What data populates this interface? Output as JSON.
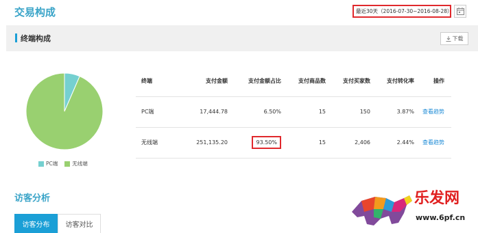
{
  "header": {
    "title": "交易构成",
    "date_range": "最近30天（2016-07-30~2016-08-28）",
    "calendar_icon": "calendar-icon"
  },
  "section": {
    "title": "终端构成",
    "download_label": "下载",
    "download_icon": "download-icon"
  },
  "pie": {
    "legend": [
      "PC端",
      "无线端"
    ],
    "colors": [
      "#75d0d0",
      "#99d070"
    ]
  },
  "chart_data": {
    "type": "pie",
    "categories": [
      "PC端",
      "无线端"
    ],
    "values": [
      6.5,
      93.5
    ],
    "legend_position": "bottom"
  },
  "table": {
    "headers": [
      "终端",
      "支付金额",
      "支付金额占比",
      "支付商品数",
      "支付买家数",
      "支付转化率",
      "操作"
    ],
    "rows": [
      [
        "PC端",
        "17,444.78",
        "6.50%",
        "15",
        "150",
        "3.87%",
        "查看趋势"
      ],
      [
        "无线端",
        "251,135.20",
        "93.50%",
        "15",
        "2,406",
        "2.44%",
        "查看趋势"
      ]
    ],
    "highlight_color": "#e0282c"
  },
  "visitor": {
    "title": "访客分析",
    "tabs": [
      "访客分布",
      "访客对比"
    ]
  },
  "watermark": {
    "brand": "乐发网",
    "url": "www.6pf.cn"
  },
  "colors": {
    "accent": "#1b9fd6",
    "title": "#3aa4c8",
    "highlight": "#e0282c"
  }
}
